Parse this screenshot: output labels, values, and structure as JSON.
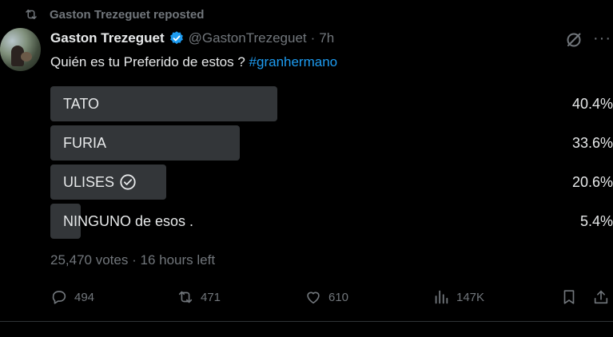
{
  "repost_label": "Gaston Trezeguet reposted",
  "author": {
    "name": "Gaston Trezeguet",
    "handle": "@GastonTrezeguet",
    "time": "7h"
  },
  "tweet": {
    "text": "Quién es tu Preferido de estos ? ",
    "hashtag": "#granhermano"
  },
  "poll": {
    "options": [
      {
        "label": "TATO",
        "percent_text": "40.4%",
        "percent": 40.4
      },
      {
        "label": "FURIA",
        "percent_text": "33.6%",
        "percent": 33.6
      },
      {
        "label": "ULISES",
        "percent_text": "20.6%",
        "percent": 20.6,
        "winner_check": true
      },
      {
        "label": "NINGUNO de esos .",
        "percent_text": "5.4%",
        "percent": 5.4
      }
    ],
    "votes": "25,470 votes",
    "separator": "·",
    "time_left": "16 hours left"
  },
  "actions": {
    "replies": "494",
    "reposts": "471",
    "likes": "610",
    "views": "147K"
  },
  "colors": {
    "background": "#000000",
    "text": "#e7e9ea",
    "muted": "#71767b",
    "accent": "#1d9bf0",
    "poll_bar": "#333639"
  }
}
